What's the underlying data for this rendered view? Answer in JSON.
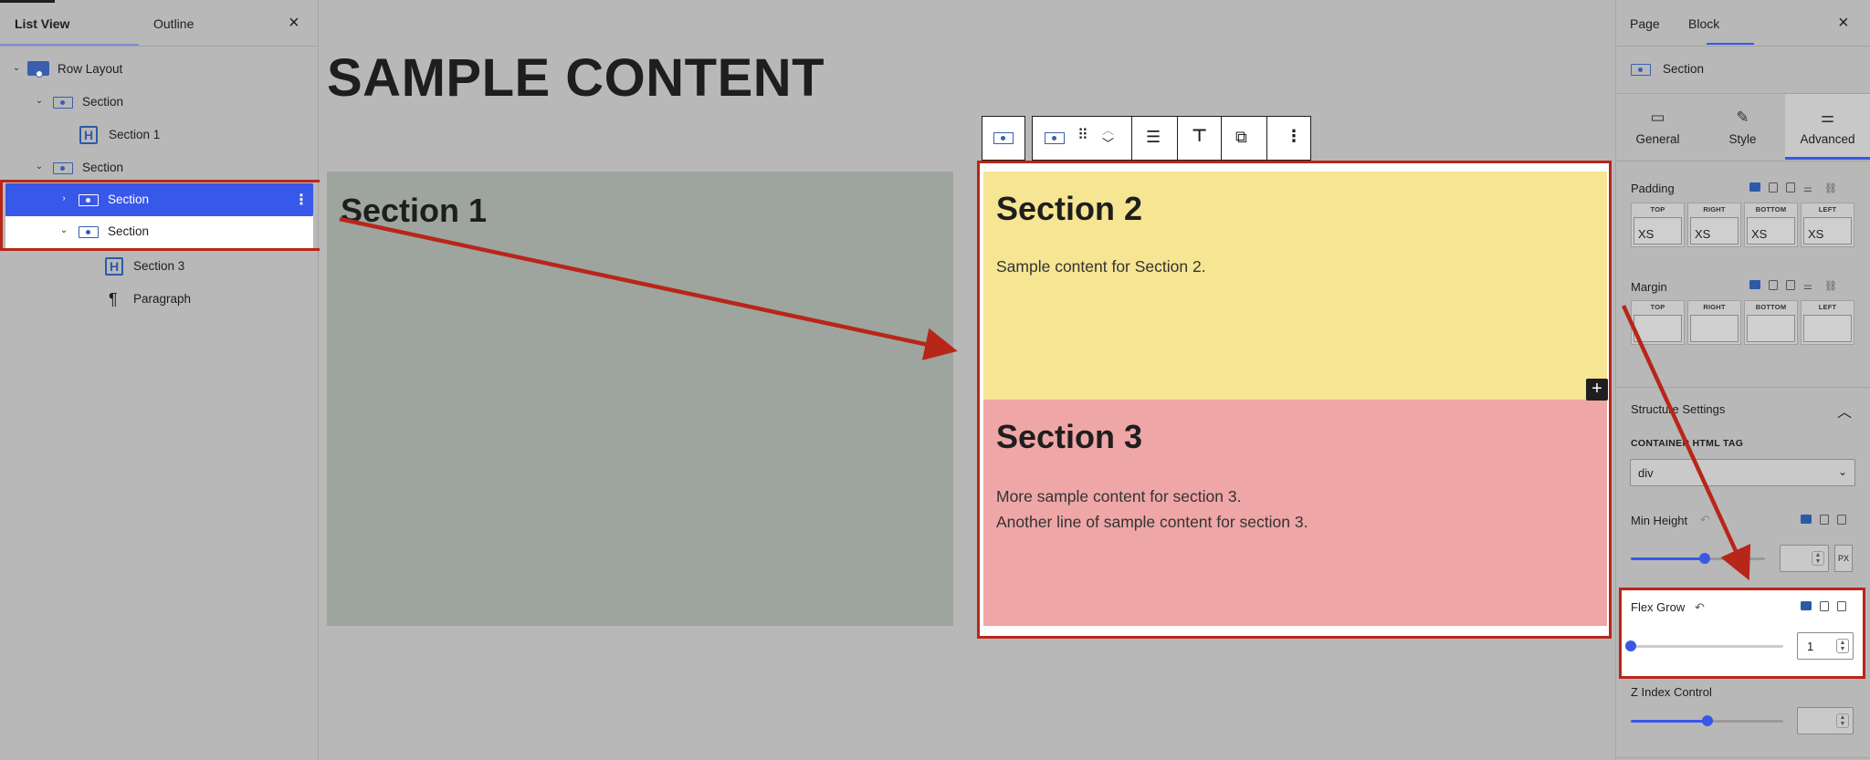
{
  "left_panel": {
    "tabs": [
      "List View",
      "Outline"
    ],
    "close_glyph": "×",
    "tree": [
      {
        "label": "Row Layout",
        "icon": "row-icon",
        "expanded": true
      },
      {
        "label": "Section",
        "icon": "section-icon",
        "expanded": true
      },
      {
        "label": "Section 1",
        "icon": "heading-icon"
      },
      {
        "label": "Section",
        "icon": "section-icon",
        "expanded": true
      },
      {
        "label": "Section",
        "icon": "section-icon",
        "selected": true,
        "expanded": false
      },
      {
        "label": "Section",
        "icon": "section-icon",
        "expanded": true
      },
      {
        "label": "Section 3",
        "icon": "heading-icon"
      },
      {
        "label": "Paragraph",
        "icon": "paragraph-icon"
      }
    ]
  },
  "canvas": {
    "page_title": "SAMPLE CONTENT",
    "section1": {
      "heading": "Section 1"
    },
    "section2": {
      "heading": "Section 2",
      "text": "Sample content for Section 2.",
      "bg": "#f6e592"
    },
    "section3": {
      "heading": "Section 3",
      "lines": [
        "More sample content for section 3.",
        "Another line of sample content for section 3."
      ],
      "bg": "#efa6a6"
    },
    "add_block_glyph": "+",
    "toolbar": {
      "icons": [
        "section-icon",
        "section-icon",
        "drag-handle-icon",
        "move-up-down-icon",
        "align-icon",
        "justify-top-icon",
        "resize-icon",
        "more-options-icon"
      ]
    }
  },
  "inspector": {
    "tabs": [
      "Page",
      "Block"
    ],
    "active_tab": "Block",
    "close_glyph": "×",
    "block_name": "Section",
    "subtabs": [
      {
        "label": "General",
        "icon": "general-icon"
      },
      {
        "label": "Style",
        "icon": "brush-icon"
      },
      {
        "label": "Advanced",
        "icon": "sliders-icon",
        "active": true
      }
    ],
    "padding": {
      "label": "Padding",
      "sides": [
        {
          "cap": "TOP",
          "value": "XS"
        },
        {
          "cap": "RIGHT",
          "value": "XS"
        },
        {
          "cap": "BOTTOM",
          "value": "XS"
        },
        {
          "cap": "LEFT",
          "value": "XS"
        }
      ]
    },
    "margin": {
      "label": "Margin",
      "sides": [
        {
          "cap": "TOP",
          "value": ""
        },
        {
          "cap": "RIGHT",
          "value": ""
        },
        {
          "cap": "BOTTOM",
          "value": ""
        },
        {
          "cap": "LEFT",
          "value": ""
        }
      ]
    },
    "structure": {
      "title": "Structure Settings",
      "container_tag_label": "CONTAINER HTML TAG",
      "container_tag_value": "div",
      "min_height_label": "Min Height",
      "min_height_unit": "PX",
      "min_height_slider": 0.55,
      "flex_grow_label": "Flex Grow",
      "flex_grow_value": "1",
      "flex_grow_slider": 0.0,
      "z_index_label": "Z Index Control",
      "z_index_slider": 0.5
    }
  },
  "highlight_color": "#b8261a",
  "accent_color": "#3858e9"
}
